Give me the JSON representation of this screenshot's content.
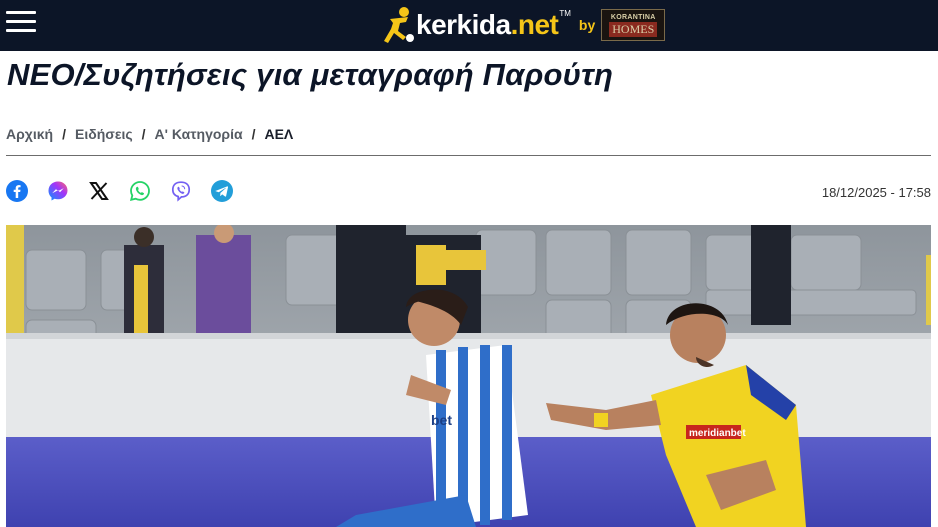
{
  "header": {
    "logo_main": "kerkida",
    "logo_accent": ".net",
    "logo_tm": "TM",
    "logo_by": "by",
    "sponsor_top": "KORANTINA",
    "sponsor_bottom": "HOMES"
  },
  "article": {
    "title": "ΝΕΟ/Συζητήσεις για μεταγραφή Παρούτη",
    "date": "18/12/2025 - 17:58",
    "breadcrumb": [
      {
        "label": "Αρχική"
      },
      {
        "label": "Ειδήσεις"
      },
      {
        "label": "Α' Κατηγορία"
      },
      {
        "label": "ΑΕΛ"
      }
    ],
    "breadcrumb_sep": "/",
    "image_texts": {
      "sponsor_left": "bet",
      "sponsor_right": "meridianbet"
    }
  },
  "share_icons": [
    "facebook-icon",
    "messenger-icon",
    "x-icon",
    "whatsapp-icon",
    "viber-icon",
    "telegram-icon"
  ],
  "colors": {
    "header_bg": "#0c1527",
    "accent": "#f5c518",
    "facebook": "#1877f2",
    "whatsapp": "#25d366",
    "viber": "#7360f2",
    "telegram": "#229ed9"
  }
}
